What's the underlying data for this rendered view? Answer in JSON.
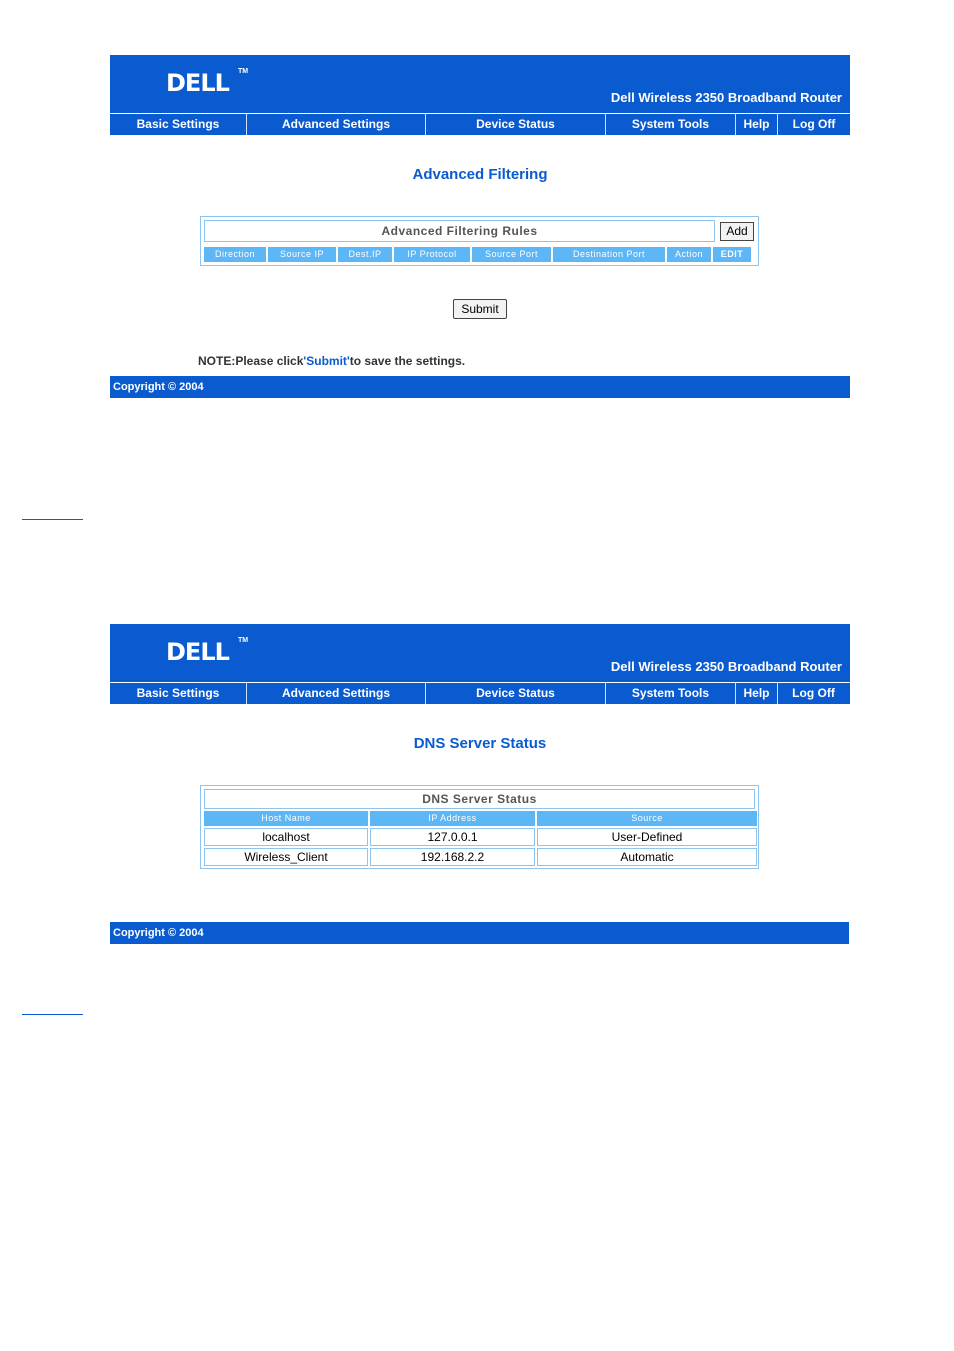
{
  "brand": {
    "logo_text": "DELL",
    "logo_tm": "TM",
    "product_name": "Dell Wireless 2350 Broadband Router"
  },
  "nav": {
    "items": [
      "Basic Settings",
      "Advanced Settings",
      "Device Status",
      "System Tools",
      "Help",
      "Log Off"
    ]
  },
  "filtering": {
    "page_title": "Advanced Filtering",
    "table_title": "Advanced Filtering Rules",
    "add_label": "Add",
    "columns": [
      "Direction",
      "Source IP",
      "Dest.IP",
      "IP Protocol",
      "Source Port",
      "Destination Port",
      "Action",
      "EDIT"
    ],
    "submit_label": "Submit",
    "note_prefix": "NOTE:Please click",
    "note_link": "'Submit'",
    "note_suffix": "to save the settings.",
    "copyright": "Copyright © 2004"
  },
  "dns": {
    "page_title": "DNS Server Status",
    "table_title": "DNS Server Status",
    "columns": [
      "Host Name",
      "IP Address",
      "Source"
    ],
    "rows": [
      [
        "localhost",
        "127.0.0.1",
        "User-Defined"
      ],
      [
        "Wireless_Client",
        "192.168.2.2",
        "Automatic"
      ]
    ],
    "copyright": "Copyright © 2004"
  },
  "colors": {
    "brand_blue": "#0a5bd0",
    "header_cell": "#5db6f5",
    "border": "#8ec5f0"
  }
}
